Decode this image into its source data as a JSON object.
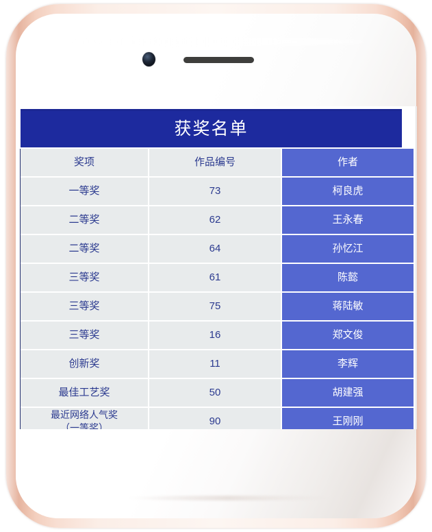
{
  "device": {
    "frame_color": "#eec0ab",
    "face_color": "#ffffff",
    "camera_icon": "camera-icon",
    "speaker_icon": "speaker-grille-icon"
  },
  "app": {
    "title": "获奖名单",
    "title_bar_color": "#1d2a9e",
    "cell_bg_color": "#e8ebec",
    "author_column_color": "#5467d0",
    "text_color": "#2b3a8f"
  },
  "table": {
    "columns": [
      "奖项",
      "作品编号",
      "作者"
    ],
    "rows": [
      {
        "award": "一等奖",
        "number": "73",
        "author": "柯良虎"
      },
      {
        "award": "二等奖",
        "number": "62",
        "author": "王永春"
      },
      {
        "award": "二等奖",
        "number": "64",
        "author": "孙忆江"
      },
      {
        "award": "三等奖",
        "number": "61",
        "author": "陈懿"
      },
      {
        "award": "三等奖",
        "number": "75",
        "author": "蒋陆敏"
      },
      {
        "award": "三等奖",
        "number": "16",
        "author": "郑文俊"
      },
      {
        "award": "创新奖",
        "number": "11",
        "author": "李辉"
      },
      {
        "award": "最佳工艺奖",
        "number": "50",
        "author": "胡建强"
      },
      {
        "award": "最近网络人气奖\n（一等奖）",
        "number": "90",
        "author": "王刚刚"
      }
    ]
  },
  "scrollbar": {
    "up_arrow": "▲",
    "down_arrow": "▼",
    "thumb_color": "#a9a9a9"
  }
}
